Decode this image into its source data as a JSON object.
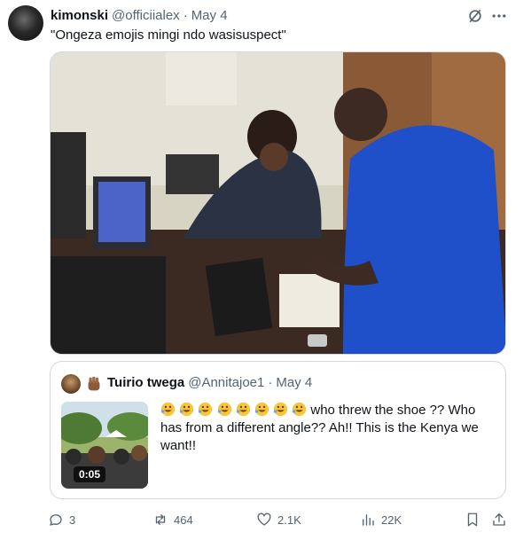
{
  "tweet": {
    "name": "kimonski",
    "handle": "@officiialex",
    "separator": "·",
    "date": "May 4",
    "text": "\"Ongeza emojis mingi ndo wasisuspect\""
  },
  "quote": {
    "name": "Tuirio twega",
    "handle": "@Annitajoe1",
    "separator": "·",
    "date": "May 4",
    "text": "who threw the shoe ?? Who has from a different angle?? Ah!! This is the Kenya we want!!",
    "emoji_count": 8,
    "video_duration": "0:05"
  },
  "actions": {
    "replies": "3",
    "reposts": "464",
    "likes": "2.1K",
    "views": "22K"
  },
  "icons": {
    "more": "more-icon",
    "grok": "grok-icon",
    "reply": "reply-icon",
    "repost": "repost-icon",
    "like": "heart-icon",
    "views": "views-icon",
    "bookmark": "bookmark-icon",
    "share": "share-icon"
  },
  "colors": {
    "text": "#0f1419",
    "secondary": "#536471",
    "border": "#cfd9de",
    "uniform_blue": "#1f4fc9"
  }
}
